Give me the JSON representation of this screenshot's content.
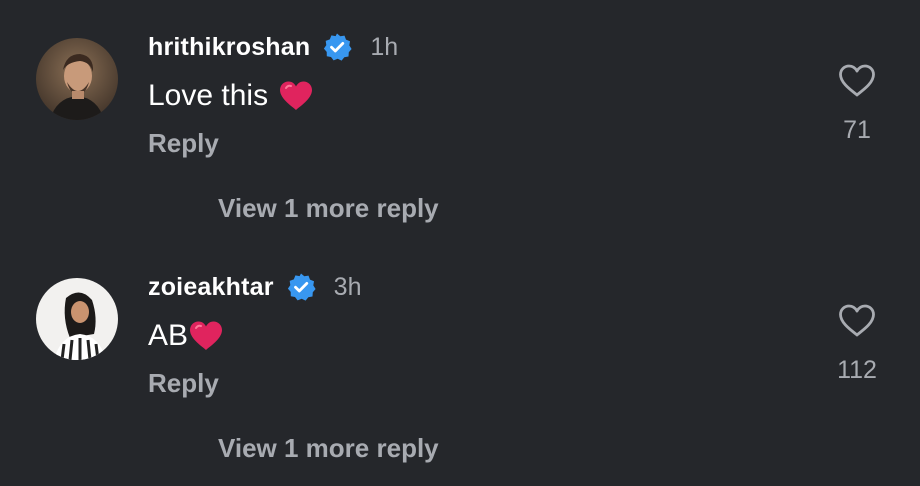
{
  "colors": {
    "background": "#25272b",
    "text_primary": "#ffffff",
    "text_secondary": "#a8abb1",
    "verified_badge": "#3897f0",
    "heart_emoji": "#e0245e"
  },
  "comments": [
    {
      "username": "hrithikroshan",
      "verified": true,
      "verified_icon": "verified-badge-icon",
      "timestamp": "1h",
      "text": "Love this",
      "emoji": "red-heart-emoji",
      "reply_label": "Reply",
      "like_icon": "heart-outline-icon",
      "like_count": "71",
      "view_replies_label": "View 1 more reply"
    },
    {
      "username": "zoieakhtar",
      "verified": true,
      "verified_icon": "verified-badge-icon",
      "timestamp": "3h",
      "text": "AB",
      "emoji": "red-heart-emoji",
      "reply_label": "Reply",
      "like_icon": "heart-outline-icon",
      "like_count": "112",
      "view_replies_label": "View 1 more reply"
    }
  ]
}
